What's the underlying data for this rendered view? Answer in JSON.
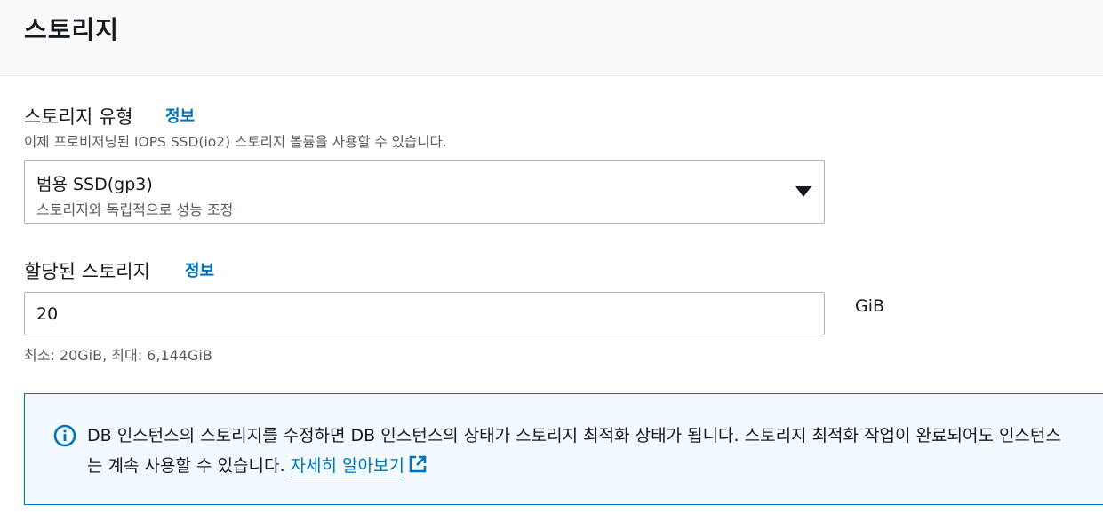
{
  "section": {
    "title": "스토리지"
  },
  "storage_type": {
    "label": "스토리지 유형",
    "info": "정보",
    "description": "이제 프로비저닝된 IOPS SSD(io2) 스토리지 볼륨을 사용할 수 있습니다.",
    "selected_value": "범용 SSD(gp3)",
    "selected_description": "스토리지와 독립적으로 성능 조정"
  },
  "allocated_storage": {
    "label": "할당된 스토리지",
    "info": "정보",
    "value": "20",
    "unit": "GiB",
    "constraint": "최소: 20GiB, 최대: 6,144GiB"
  },
  "alert": {
    "text": "DB 인스턴스의 스토리지를 수정하면 DB 인스턴스의 상태가 스토리지 최적화 상태가 됩니다. 스토리지 최적화 작업이 완료되어도 인스턴스는 계속 사용할 수 있습니다. ",
    "link": "자세히 알아보기",
    "accent_color": "#0073bb",
    "background_color": "#f1faff"
  },
  "icons": {
    "info": "info-circle-icon",
    "external": "external-link-icon",
    "caret": "caret-down-icon"
  }
}
